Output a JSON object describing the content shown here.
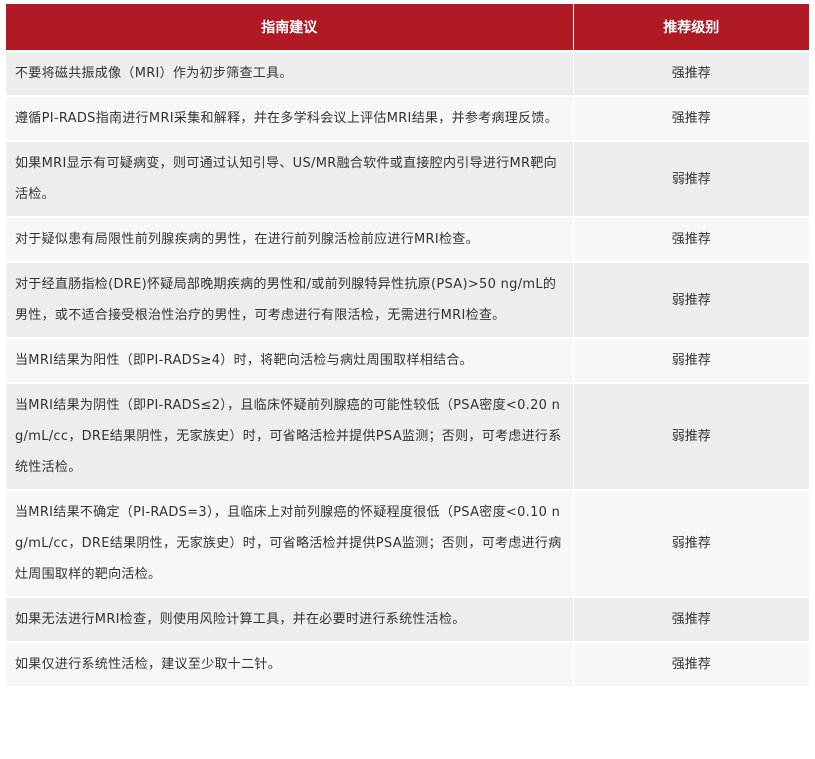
{
  "header": {
    "guideline_label": "指南建议",
    "grade_label": "推荐级别"
  },
  "colors": {
    "header_bg": "#b01a24",
    "row_odd_bg": "#ededed",
    "row_even_bg": "#f7f7f7"
  },
  "rows": [
    {
      "text": "不要将磁共振成像（MRI）作为初步筛查工具。",
      "grade": "强推荐"
    },
    {
      "text": "遵循PI-RADS指南进行MRI采集和解释，并在多学科会议上评估MRI结果，并参考病理反馈。",
      "grade": "强推荐"
    },
    {
      "text": "如果MRI显示有可疑病变，则可通过认知引导、US/MR融合软件或直接腔内引导进行MR靶向活检。",
      "grade": "弱推荐"
    },
    {
      "text": "对于疑似患有局限性前列腺疾病的男性，在进行前列腺活检前应进行MRI检查。",
      "grade": "强推荐"
    },
    {
      "text": "对于经直肠指检(DRE)怀疑局部晚期疾病的男性和/或前列腺特异性抗原(PSA)>50 ng/mL的男性，或不适合接受根治性治疗的男性，可考虑进行有限活检，无需进行MRI检查。",
      "grade": "弱推荐"
    },
    {
      "text": "当MRI结果为阳性（即PI-RADS≥4）时，将靶向活检与病灶周围取样相结合。",
      "grade": "弱推荐"
    },
    {
      "text": "当MRI结果为阴性（即PI-RADS≤2），且临床怀疑前列腺癌的可能性较低（PSA密度<0.20 ng/mL/cc，DRE结果阴性，无家族史）时，可省略活检并提供PSA监测；否则，可考虑进行系统性活检。",
      "grade": "弱推荐"
    },
    {
      "text": "当MRI结果不确定（PI-RADS=3），且临床上对前列腺癌的怀疑程度很低（PSA密度<0.10 ng/mL/cc，DRE结果阴性，无家族史）时，可省略活检并提供PSA监测；否则，可考虑进行病灶周围取样的靶向活检。",
      "grade": "弱推荐"
    },
    {
      "text": "如果无法进行MRI检查，则使用风险计算工具，并在必要时进行系统性活检。",
      "grade": "强推荐"
    },
    {
      "text": "如果仅进行系统性活检，建议至少取十二针。",
      "grade": "强推荐"
    }
  ]
}
